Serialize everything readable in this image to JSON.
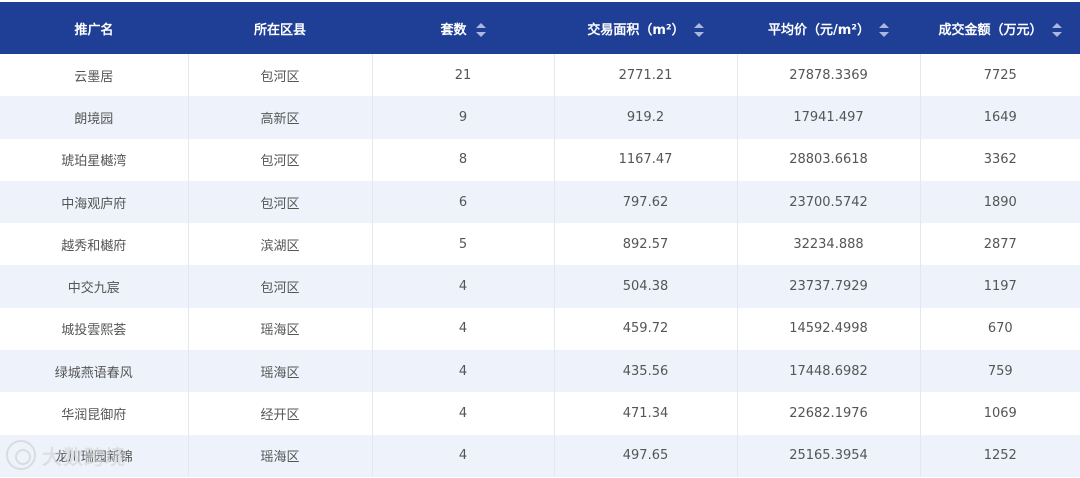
{
  "table": {
    "headers": [
      {
        "label": "推广名",
        "sortable": false
      },
      {
        "label": "所在区县",
        "sortable": false
      },
      {
        "label": "套数",
        "sortable": true
      },
      {
        "label": "交易面积（m²）",
        "sortable": true
      },
      {
        "label": "平均价（元/m²）",
        "sortable": true
      },
      {
        "label": "成交金额（万元）",
        "sortable": true
      }
    ],
    "rows": [
      [
        "云墨居",
        "包河区",
        "21",
        "2771.21",
        "27878.3369",
        "7725"
      ],
      [
        "朗境园",
        "高新区",
        "9",
        "919.2",
        "17941.497",
        "1649"
      ],
      [
        "琥珀星樾湾",
        "包河区",
        "8",
        "1167.47",
        "28803.6618",
        "3362"
      ],
      [
        "中海观庐府",
        "包河区",
        "6",
        "797.62",
        "23700.5742",
        "1890"
      ],
      [
        "越秀和樾府",
        "滨湖区",
        "5",
        "892.57",
        "32234.888",
        "2877"
      ],
      [
        "中交九宸",
        "包河区",
        "4",
        "504.38",
        "23737.7929",
        "1197"
      ],
      [
        "城投雲熙荟",
        "瑶海区",
        "4",
        "459.72",
        "14592.4998",
        "670"
      ],
      [
        "绿城燕语春风",
        "瑶海区",
        "4",
        "435.56",
        "17448.6982",
        "759"
      ],
      [
        "华润昆御府",
        "经开区",
        "4",
        "471.34",
        "22682.1976",
        "1069"
      ],
      [
        "龙川瑞园新锦",
        "瑶海区",
        "4",
        "497.65",
        "25165.3954",
        "1252"
      ]
    ]
  },
  "watermark": {
    "text": "大数跨境",
    "icon": "brand-logo-icon"
  },
  "colors": {
    "header_bg": "#1f3f96",
    "header_text": "#ffffff",
    "row_alt_bg": "#eef3fb",
    "cell_text": "#555555"
  }
}
